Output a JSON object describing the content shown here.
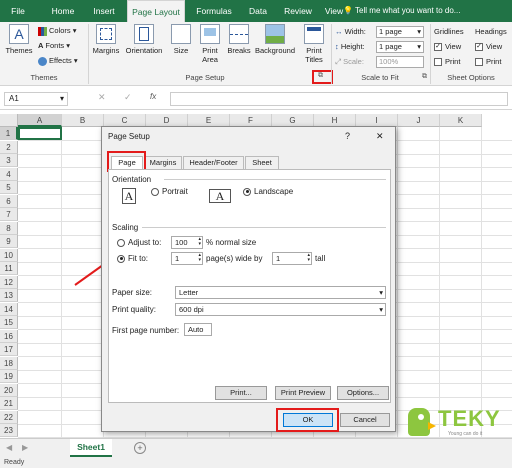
{
  "ribbon_tabs": [
    "File",
    "Home",
    "Insert",
    "Page Layout",
    "Formulas",
    "Data",
    "Review",
    "View"
  ],
  "tell_me": "Tell me what you want to do...",
  "ribbon": {
    "themes": {
      "themes_label": "Themes",
      "colors": "Colors",
      "fonts": "Fonts",
      "effects": "Effects",
      "group": "Themes"
    },
    "page_setup": {
      "buttons": [
        "Margins",
        "Orientation",
        "Size",
        "Print Area",
        "Breaks",
        "Background",
        "Print Titles"
      ],
      "group": "Page Setup"
    },
    "scale": {
      "width_label": "Width:",
      "width_value": "1 page",
      "height_label": "Height:",
      "height_value": "1 page",
      "scale_label": "Scale:",
      "scale_value": "100%",
      "group": "Scale to Fit"
    },
    "sheet_options": {
      "gridlines": "Gridlines",
      "headings": "Headings",
      "view": "View",
      "print": "Print",
      "group": "Sheet Options"
    }
  },
  "formula_bar": {
    "name_box": "A1",
    "fx": "fx"
  },
  "columns": [
    "A",
    "B",
    "C",
    "D",
    "E",
    "F",
    "G",
    "H",
    "I",
    "J",
    "K"
  ],
  "rows": [
    "1",
    "2",
    "3",
    "4",
    "5",
    "6",
    "7",
    "8",
    "9",
    "10",
    "11",
    "12",
    "13",
    "14",
    "15",
    "16",
    "17",
    "18",
    "19",
    "20",
    "21",
    "22",
    "23"
  ],
  "sheet_tab": "Sheet1",
  "status": "Ready",
  "dialog": {
    "title": "Page Setup",
    "help": "?",
    "close": "✕",
    "tabs": [
      "Page",
      "Margins",
      "Header/Footer",
      "Sheet"
    ],
    "orientation_label": "Orientation",
    "portrait": "Portrait",
    "landscape": "Landscape",
    "scaling_label": "Scaling",
    "adjust_to": "Adjust to:",
    "adjust_value": "100",
    "normal_size": "% normal size",
    "fit_to": "Fit to:",
    "fit_wide": "1",
    "pages_wide_by": "page(s) wide by",
    "fit_tall": "1",
    "tall": "tall",
    "paper_size_label": "Paper size:",
    "paper_size": "Letter",
    "print_quality_label": "Print quality:",
    "print_quality": "600 dpi",
    "first_page_label": "First page number:",
    "first_page": "Auto",
    "print_btn": "Print...",
    "preview_btn": "Print Preview",
    "options_btn": "Options...",
    "ok": "OK",
    "cancel": "Cancel"
  },
  "watermark": {
    "brand": "TEKY",
    "tagline": "Young can do it"
  },
  "colors": {
    "excel_green": "#217346",
    "highlight_red": "#e31b1b",
    "dialog_bg": "#f0f0f0",
    "ok_blue": "#cce4f7"
  }
}
